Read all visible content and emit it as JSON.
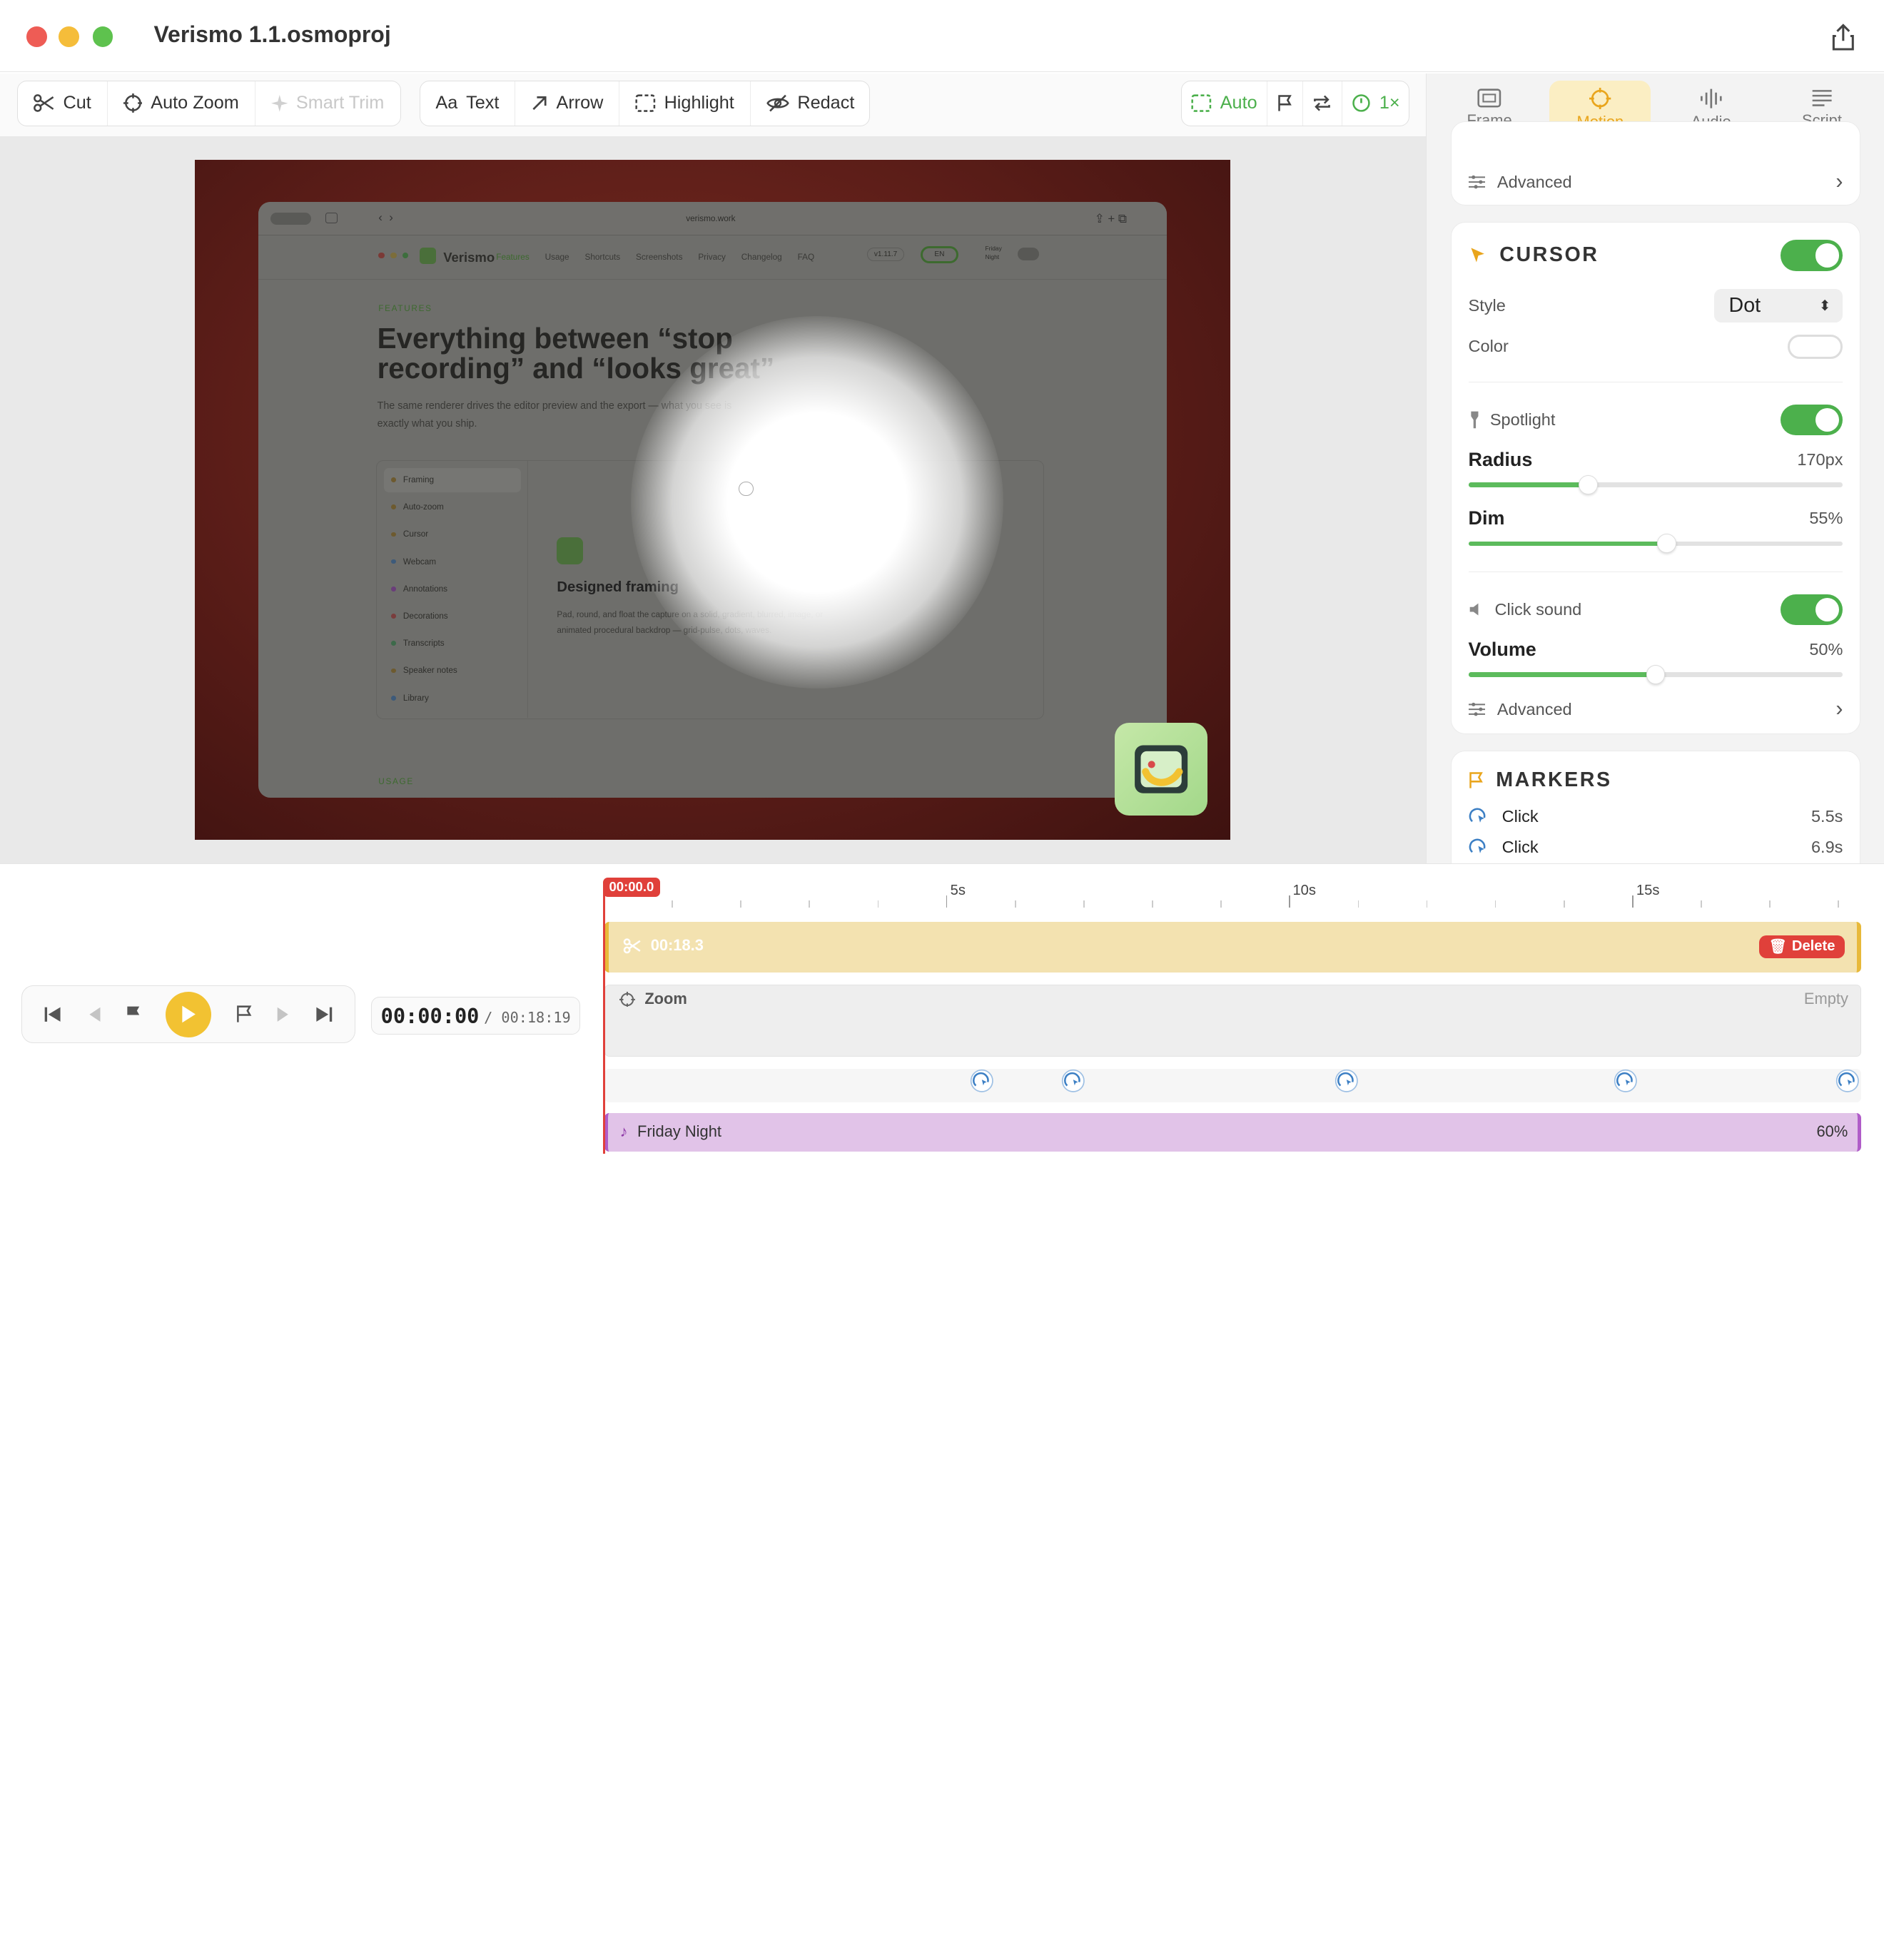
{
  "window": {
    "title": "Verismo 1.1.osmoproj"
  },
  "toolbar": {
    "cut": "Cut",
    "auto_zoom": "Auto Zoom",
    "smart_trim": "Smart Trim",
    "text": "Text",
    "arrow": "Arrow",
    "highlight": "Highlight",
    "redact": "Redact",
    "auto": "Auto",
    "speed": "1×"
  },
  "preview": {
    "url": "verismo.work",
    "brand": "Verismo",
    "nav": [
      "Features",
      "Usage",
      "Shortcuts",
      "Screenshots",
      "Privacy",
      "Changelog",
      "FAQ"
    ],
    "version": "v1.11.7",
    "lang": "EN",
    "theme_lines": [
      "Friday",
      "Night"
    ],
    "eyebrow": "FEATURES",
    "headline_1": "Everything between “stop",
    "headline_2": "recording” and “looks great”",
    "sub_1": "The same renderer drives the editor preview and the export — what you see is",
    "sub_2": "exactly what you ship.",
    "sidebar": [
      "Framing",
      "Auto-zoom",
      "Cursor",
      "Webcam",
      "Annotations",
      "Decorations",
      "Transcripts",
      "Speaker notes",
      "Library"
    ],
    "card_title": "Designed framing",
    "card_text_1": "Pad, round, and float the capture on a solid, gradient, blurred, image, or",
    "card_text_2": "animated procedural backdrop — grid-pulse, dots, waves.",
    "eyebrow_2": "USAGE"
  },
  "panel": {
    "tabs": [
      {
        "label": "Frame",
        "icon": "frame-icon"
      },
      {
        "label": "Motion",
        "icon": "motion-icon",
        "active": true
      },
      {
        "label": "Audio",
        "icon": "audio-icon"
      },
      {
        "label": "Script",
        "icon": "script-icon"
      }
    ],
    "advanced_top": "Advanced",
    "cursor": {
      "title": "CURSOR",
      "enabled": true,
      "style_label": "Style",
      "style_value": "Dot",
      "color_label": "Color",
      "spotlight_label": "Spotlight",
      "spotlight_enabled": true,
      "radius_label": "Radius",
      "radius_value": "170px",
      "radius_fraction": 0.32,
      "dim_label": "Dim",
      "dim_value": "55%",
      "dim_fraction": 0.53,
      "click_sound_label": "Click sound",
      "click_sound_enabled": true,
      "volume_label": "Volume",
      "volume_value": "50%",
      "volume_fraction": 0.5,
      "advanced": "Advanced"
    },
    "markers": {
      "title": "MARKERS",
      "items": [
        {
          "label": "Click",
          "time": "5.5s"
        },
        {
          "label": "Click",
          "time": "6.9s"
        }
      ]
    }
  },
  "timeline": {
    "playhead": "00:00.0",
    "ruler_labels": [
      "5s",
      "10s",
      "15s"
    ],
    "clip_duration": "00:18.3",
    "delete_label": "Delete",
    "zoom_label": "Zoom",
    "zoom_empty": "Empty",
    "audio_label": "Friday Night",
    "audio_volume": "60%",
    "current_time": "00:00:00",
    "total_time": "/ 00:18:19"
  },
  "colors": {
    "accent": "#e9a51c",
    "toggle": "#4cb04c",
    "delete": "#e0403a",
    "audio": "#e1c3e8",
    "clip": "#f3e2b0"
  }
}
